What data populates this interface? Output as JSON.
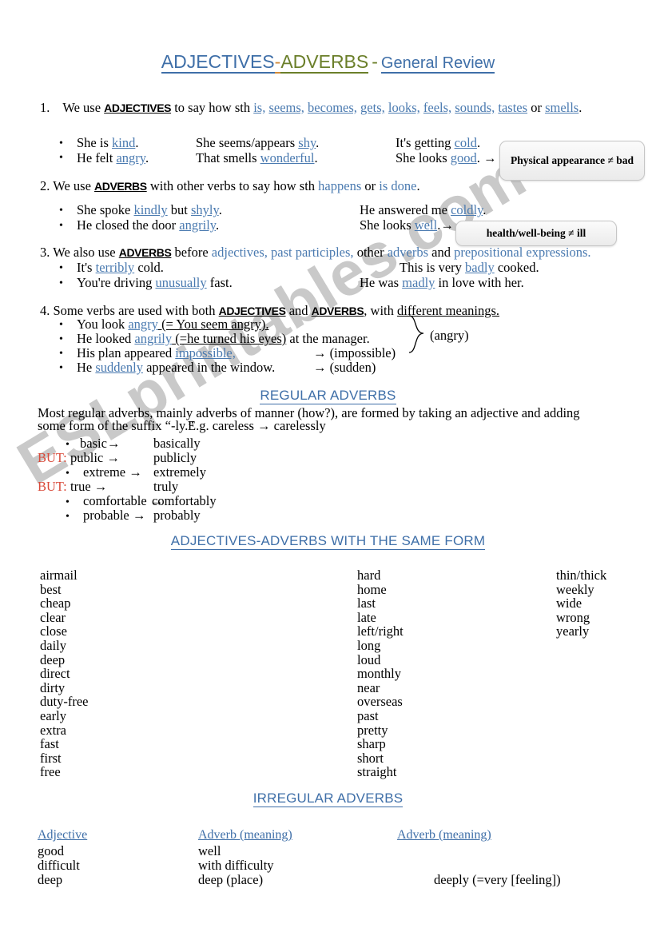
{
  "watermark": {
    "text": "ESLprintables.com"
  },
  "title": {
    "adjectives": "ADJECTIVES",
    "separator": "-",
    "adverbs": "ADVERBS",
    "dash": "-",
    "general_review": "General Review",
    "color_adjectives": "#3f6fa8",
    "color_adverbs": "#6b7f2a"
  },
  "rule1": {
    "number": "1.",
    "lead": "We use",
    "keyword": "ADJECTIVES",
    "mid": "to say how sth",
    "verbs": [
      "is,",
      "seems,",
      "becomes,",
      "gets,",
      "looks,",
      "feels,",
      "sounds,",
      "tastes"
    ],
    "or": "or",
    "last_verb": "smells",
    "period": ".",
    "examples": [
      {
        "col1": "She is kind.",
        "col2": "She seems/appears shy.",
        "col3": "It's getting cold."
      },
      {
        "col1": "He felt angry.",
        "col2": "That smells wonderful.",
        "col3": "She looks good."
      }
    ],
    "arrow": "→",
    "callout": "Physical appearance ≠ bad"
  },
  "rule2": {
    "number": "2.",
    "lead": "We use",
    "keyword": "ADVERBS",
    "mid": "with other verbs to say how sth",
    "verb1": "happens",
    "or": "or",
    "verb2": "is done",
    "period": ".",
    "examples": [
      {
        "col1": "She spoke kindly but shyly.",
        "col2": "He answered me coldly."
      },
      {
        "col1": "He closed the door angrily.",
        "col2": "She looks well."
      }
    ],
    "arrow": "→",
    "callout": "health/well-being ≠ ill"
  },
  "rule3": {
    "number": "3.",
    "lead": "We also use",
    "keyword": "ADVERBS",
    "mid": "before",
    "terms": [
      "adjectives,",
      "past participles,",
      "adverbs",
      "prepositional expressions."
    ],
    "other": "other",
    "and": "and",
    "examples": [
      {
        "col1": "It's terribly cold.",
        "col2": "This is very badly cooked."
      },
      {
        "col1": "You're driving unusually fast.",
        "col2": "He was madly in love with her."
      }
    ]
  },
  "rule4": {
    "number": "4.",
    "lead": "Some verbs are used with both",
    "keyword1": "ADJECTIVES",
    "and": "and",
    "keyword2": "ADVERBS",
    "tail": ", with",
    "tail_underlined": "different meanings.",
    "examples": [
      {
        "text": "You look angry (= You seem angry).",
        "result": ""
      },
      {
        "text": "He looked angrily (=he turned his eyes)  at the manager.",
        "result": ""
      },
      {
        "text": "His plan appeared  impossible,",
        "result": "→ (impossible)"
      },
      {
        "text": "He suddenly appeared in the window.",
        "result": "→ (sudden)"
      }
    ],
    "brace_label": "(angry)"
  },
  "regular_adverbs": {
    "heading": "REGULAR ADVERBS",
    "intro_line1": "Most regular adverbs, mainly adverbs of manner (how?), are formed by taking an adjective and adding",
    "intro_line2": "some form of the suffix “-ly.”",
    "example": "E.g. careless → carelessly",
    "but_label": "BUT:",
    "rows": [
      {
        "marker": "bullet",
        "adjective": "basic→",
        "adverb": "basically"
      },
      {
        "marker": "but",
        "adjective": "public →",
        "adverb": "publicly"
      },
      {
        "marker": "bullet",
        "adjective": "extreme →",
        "adverb": "extremely"
      },
      {
        "marker": "but",
        "adjective": "true →",
        "adverb": "truly"
      },
      {
        "marker": "bullet",
        "adjective": "comfortable →",
        "adverb": "comfortably"
      },
      {
        "marker": "bullet",
        "adjective": "probable →",
        "adverb": "probably"
      }
    ]
  },
  "same_form": {
    "heading": "ADJECTIVES-ADVERBS WITH THE SAME FORM",
    "col1": [
      "airmail",
      "best",
      "cheap",
      "clear",
      "close",
      "daily",
      "deep",
      "direct",
      "dirty",
      "duty-free",
      "early",
      "extra",
      "fast",
      "first",
      "free"
    ],
    "col2": [
      "hard",
      "home",
      "last",
      "late",
      "left/right",
      "long",
      "loud",
      "monthly",
      "near",
      "overseas",
      "past",
      "pretty",
      "sharp",
      "short",
      "straight"
    ],
    "col3": [
      "thin/thick",
      "weekly",
      "wide",
      "wrong",
      "yearly"
    ]
  },
  "irregular": {
    "heading": "IRREGULAR ADVERBS",
    "headers": [
      "Adjective ",
      "Adverb  (meaning)",
      "Adverb (meaning)"
    ],
    "rows": [
      {
        "adjective": "good",
        "adverb1": "well",
        "adverb2": ""
      },
      {
        "adjective": "difficult",
        "adverb1": "with difficulty",
        "adverb2": ""
      },
      {
        "adjective": "deep",
        "adverb1": "deep (place)",
        "adverb2": "deeply (=very [feeling])"
      }
    ]
  }
}
